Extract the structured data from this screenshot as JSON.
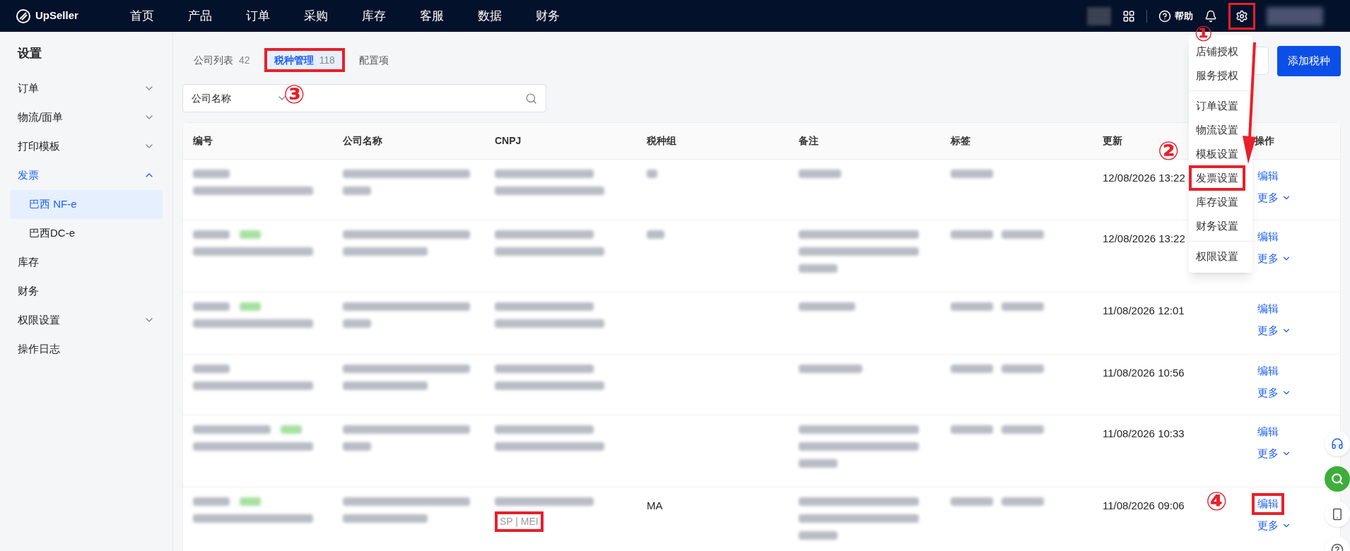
{
  "nav": {
    "logo": "UpSeller",
    "items": [
      "首页",
      "产品",
      "订单",
      "采购",
      "库存",
      "客服",
      "数据",
      "财务"
    ],
    "help": "帮助",
    "settings_highlighted": true
  },
  "sidebar": {
    "title": "设置",
    "items": [
      {
        "label": "订单",
        "expanded": false,
        "selected": false
      },
      {
        "label": "物流/面单",
        "expanded": false,
        "selected": false
      },
      {
        "label": "打印模板",
        "expanded": false,
        "selected": false
      },
      {
        "label": "发票",
        "expanded": true,
        "selected": true,
        "children": [
          {
            "label": "巴西 NF-e",
            "selected": true
          },
          {
            "label": "巴西DC-e",
            "selected": false
          }
        ]
      },
      {
        "label": "库存",
        "selected": false
      },
      {
        "label": "财务",
        "selected": false
      },
      {
        "label": "权限设置",
        "expanded": false,
        "selected": false
      },
      {
        "label": "操作日志",
        "selected": false
      }
    ]
  },
  "tabs": [
    {
      "label": "公司列表",
      "count": "42",
      "selected": false,
      "highlighted": false
    },
    {
      "label": "税种管理",
      "count": "118",
      "selected": true,
      "highlighted": true
    },
    {
      "label": "配置项",
      "selected": false,
      "highlighted": false
    }
  ],
  "add_button": "添加税种",
  "search": {
    "field": "公司名称"
  },
  "table": {
    "columns": [
      "编号",
      "公司名称",
      "CNPJ",
      "税种组",
      "备注",
      "标签",
      "更新",
      "操作"
    ],
    "rows": [
      {
        "tagged": false,
        "updated": "12/08/2026 13:22",
        "edit": "编辑",
        "more": "更多",
        "edit_highlighted": false
      },
      {
        "tagged": true,
        "updated": "12/08/2026 13:22",
        "edit": "编辑",
        "more": "更多",
        "edit_highlighted": false
      },
      {
        "tagged": true,
        "updated": "11/08/2026 12:01",
        "edit": "编辑",
        "more": "更多",
        "edit_highlighted": false
      },
      {
        "tagged": false,
        "updated": "11/08/2026 10:56",
        "edit": "编辑",
        "more": "更多",
        "edit_highlighted": false
      },
      {
        "tagged": true,
        "updated": "11/08/2026 10:33",
        "edit": "编辑",
        "more": "更多",
        "edit_highlighted": false
      },
      {
        "tagged": true,
        "cnpj_note": "SP | MEI",
        "cnpj_note_highlighted": true,
        "tax_group": "MA",
        "updated": "11/08/2026 09:06",
        "edit": "编辑",
        "more": "更多",
        "edit_highlighted": true
      }
    ]
  },
  "settings_menu": {
    "groups": [
      [
        {
          "label": "店铺授权",
          "highlighted": false
        },
        {
          "label": "服务授权",
          "highlighted": false
        }
      ],
      [
        {
          "label": "订单设置",
          "highlighted": false
        },
        {
          "label": "物流设置",
          "highlighted": false
        },
        {
          "label": "模板设置",
          "highlighted": false
        },
        {
          "label": "发票设置",
          "highlighted": true
        },
        {
          "label": "库存设置",
          "highlighted": false
        },
        {
          "label": "财务设置",
          "highlighted": false
        }
      ],
      [
        {
          "label": "权限设置",
          "highlighted": false
        }
      ]
    ]
  },
  "annotations": [
    {
      "label": "①"
    },
    {
      "label": "②"
    },
    {
      "label": "③"
    },
    {
      "label": "④"
    }
  ]
}
